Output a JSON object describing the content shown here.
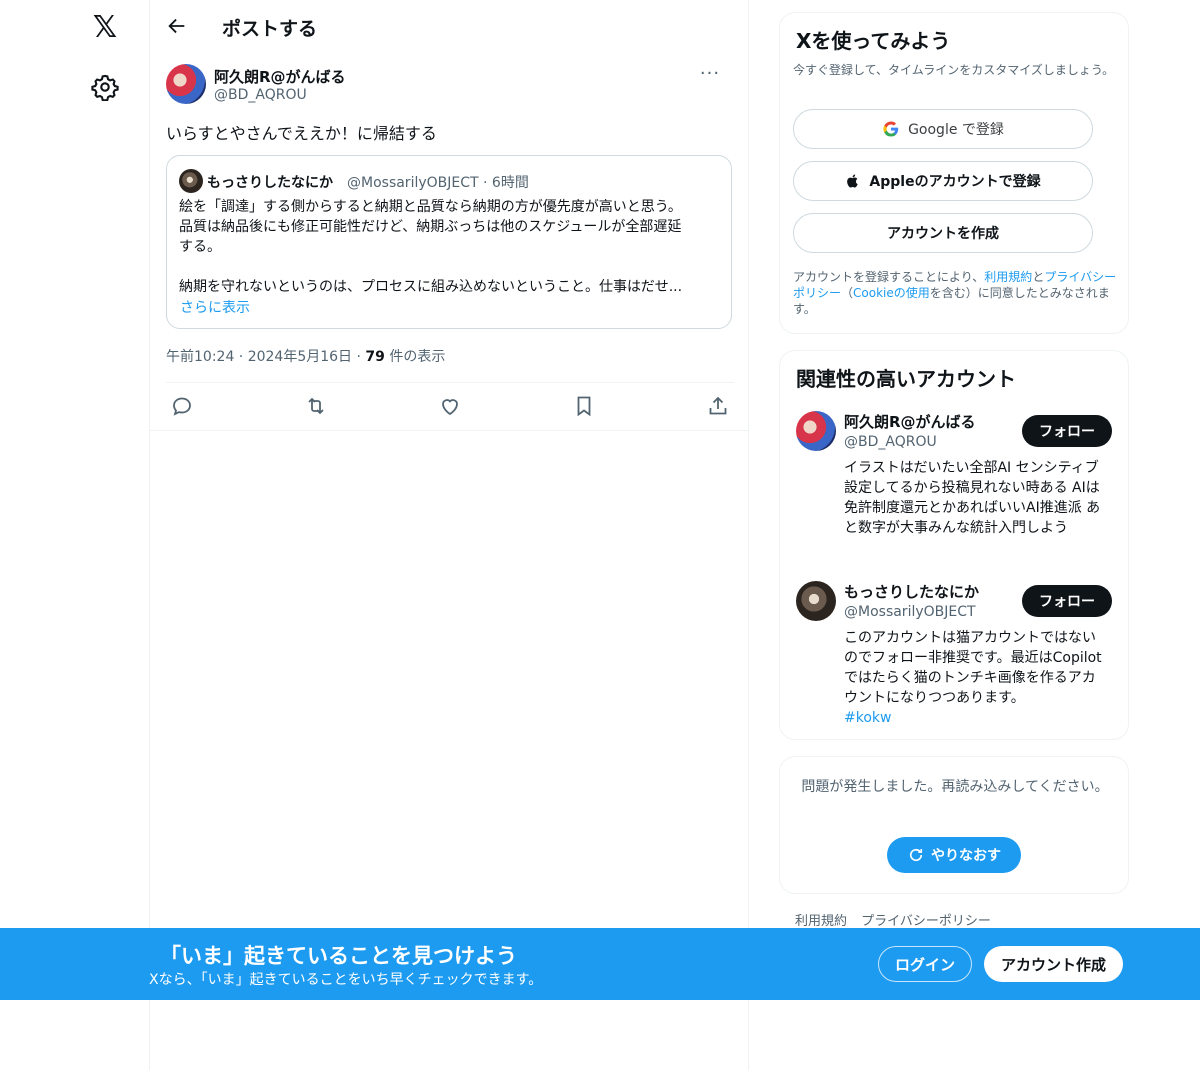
{
  "topbar": {
    "title": "ポストする"
  },
  "post": {
    "author_name": "阿久朗R@がんばる",
    "author_handle": "@BD_AQROU",
    "more_label": "···",
    "text": "いらすとやさんでええか！に帰結する",
    "quote": {
      "name": "もっさりしたなにか",
      "handle": "@MossarilyOBJECT · 6時間",
      "lines": [
        "絵を「調達」する側からすると納期と品質なら納期の方が優先度が高いと思う。",
        "品質は納品後にも修正可能性だけど、納期ぶっちは他のスケジュールが全部遅延",
        "する。",
        "",
        "納期を守れないというのは、プロセスに組み込めないということ。仕事はだせ..."
      ],
      "show_more": "さらに表示"
    },
    "meta": {
      "time": "午前10:24 · 2024年5月16日 · ",
      "views": "79",
      "views_suffix": " 件の表示"
    },
    "actions": [
      "reply-icon",
      "retweet-icon",
      "like-icon",
      "bookmark-icon",
      "share-icon"
    ]
  },
  "signup": {
    "title": "Xを使ってみよう",
    "subtitle": "今すぐ登録して、タイムラインをカスタマイズしましょう。",
    "google_label": "Google で登録",
    "apple_label": "Appleのアカウントで登録",
    "create_label": "アカウントを作成",
    "legal": {
      "p1": "アカウントを登録することにより、",
      "terms": "利用規約",
      "p2": "と",
      "privacy": "プライバシーポリシー",
      "p3": "（",
      "cookie": "Cookieの使用",
      "p4": "を含む）に同意したとみなされます。"
    }
  },
  "related": {
    "title": "関連性の高いアカウント",
    "accounts": [
      {
        "name": "阿久朗R@がんばる",
        "handle": "@BD_AQROU",
        "follow": "フォロー",
        "bio": "イラストはだいたい全部AI センシティブ設定してるから投稿見れない時ある AIは免許制度還元とかあればいいAI推進派 あと数字が大事みんな統計入門しよう"
      },
      {
        "name": "もっさりしたなにか",
        "handle": "@MossarilyOBJECT",
        "follow": "フォロー",
        "bio": "このアカウントは猫アカウントではないのでフォロー非推奨です。最近はCopilotではたらく猫のトンチキ画像を作るアカウントになりつつあります。",
        "hashtag": "#kokw"
      }
    ]
  },
  "error_card": {
    "text": "問題が発生しました。再読み込みしてください。",
    "retry": "やりなおす"
  },
  "footer": {
    "terms": "利用規約",
    "privacy": "プライバシーポリシー"
  },
  "banner": {
    "title": "「いま」起きていることを見つけよう",
    "subtitle": "Xなら、「いま」起きていることをいち早くチェックできます。",
    "login": "ログイン",
    "signup": "アカウント作成"
  },
  "colors": {
    "accent": "#1d9bf0",
    "text": "#0f1419",
    "muted": "#536471",
    "border": "#eff3f4"
  }
}
